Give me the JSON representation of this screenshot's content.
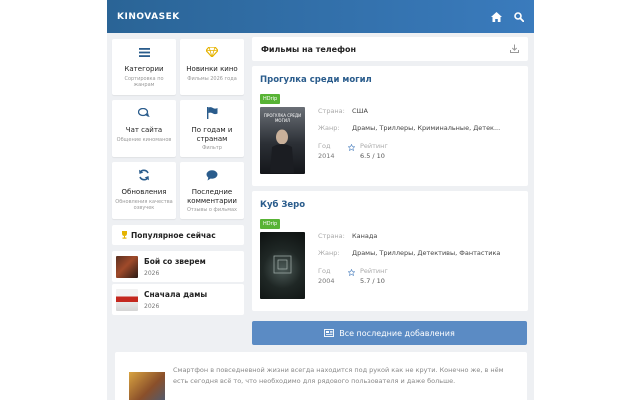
{
  "header": {
    "logo": "KINOVASEK",
    "icons": [
      "home-icon",
      "search-icon"
    ],
    "color": "#2a6496"
  },
  "sidebar": {
    "tiles": [
      {
        "title": "Категории",
        "subtitle": "Сортировка по жанрам",
        "icon": "list-icon"
      },
      {
        "title": "Новинки кино",
        "subtitle": "Фильмы 2026 года",
        "icon": "diamond-icon"
      },
      {
        "title": "Чат сайта",
        "subtitle": "Общение киноманов",
        "icon": "chat-icon"
      },
      {
        "title": "По годам и странам",
        "subtitle": "Фильтр",
        "icon": "flag-icon"
      },
      {
        "title": "Обновления",
        "subtitle": "Обновления качества озвучек",
        "icon": "refresh-icon"
      },
      {
        "title": "Последние комментарии",
        "subtitle": "Отзывы о фильмах",
        "icon": "comment-icon"
      }
    ],
    "popular": {
      "heading": "Популярное сейчас",
      "items": [
        {
          "title": "Бой со зверем",
          "year": "2026"
        },
        {
          "title": "Сначала дамы",
          "year": "2026"
        }
      ]
    }
  },
  "main": {
    "heading": "Фильмы на телефон",
    "movies": [
      {
        "title": "Прогулка среди могил",
        "badge": "HDrip",
        "poster_text": "ПРОГУЛКА СРЕДИ МОГИЛ",
        "country_label": "Страна:",
        "country": "США",
        "genre_label": "Жанр:",
        "genre": "Драмы, Триллеры, Криминальные, Детек...",
        "year_label": "Год",
        "year": "2014",
        "rating_label": "Рейтинг",
        "rating": "6.5 / 10"
      },
      {
        "title": "Куб Зеро",
        "badge": "HDrip",
        "poster_text": "",
        "country_label": "Страна:",
        "country": "Канада",
        "genre_label": "Жанр:",
        "genre": "Драмы, Триллеры, Детективы, Фантастика",
        "year_label": "Год",
        "year": "2004",
        "rating_label": "Рейтинг",
        "rating": "5.7 / 10"
      }
    ],
    "latest_button": "Все последние добавления",
    "bottom_text": "Смартфон в повседневной жизни всегда находится под рукой как не крути. Конечно же, в нём есть сегодня всё то, что необходимо для рядового пользователя и даже больше."
  },
  "colors": {
    "accent": "#2a6496",
    "badge": "#58b335",
    "button": "#5b8bc4",
    "title": "#2a5c8c"
  }
}
